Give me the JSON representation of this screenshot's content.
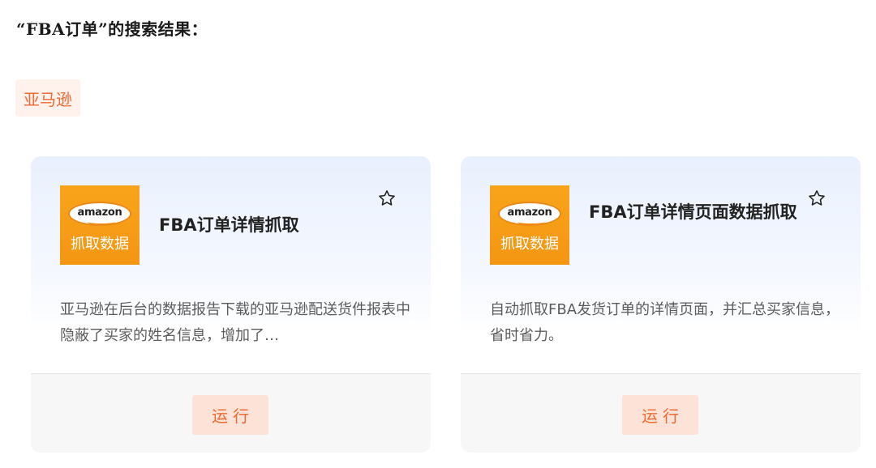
{
  "search": {
    "heading": "“FBA订单”的搜索结果："
  },
  "category": {
    "label": "亚马逊"
  },
  "cards": [
    {
      "logo_word": "amazon",
      "logo_caption": "抓取数据",
      "title": "FBA订单详情抓取",
      "description": "亚马逊在后台的数据报告下载的亚马逊配送货件报表中隐蔽了买家的姓名信息，增加了…",
      "icon": "star-icon",
      "run_label": "运行"
    },
    {
      "logo_word": "amazon",
      "logo_caption": "抓取数据",
      "title": "FBA订单详情页面数据抓取",
      "description": "自动抓取FBA发货订单的详情页面，并汇总买家信息，省时省力。",
      "icon": "star-icon",
      "run_label": "运行"
    }
  ],
  "colors": {
    "accent": "#f06a32",
    "tag_bg": "#fff1ec",
    "button_bg": "#fde2d7",
    "logo_orange": "#f7a01a"
  }
}
